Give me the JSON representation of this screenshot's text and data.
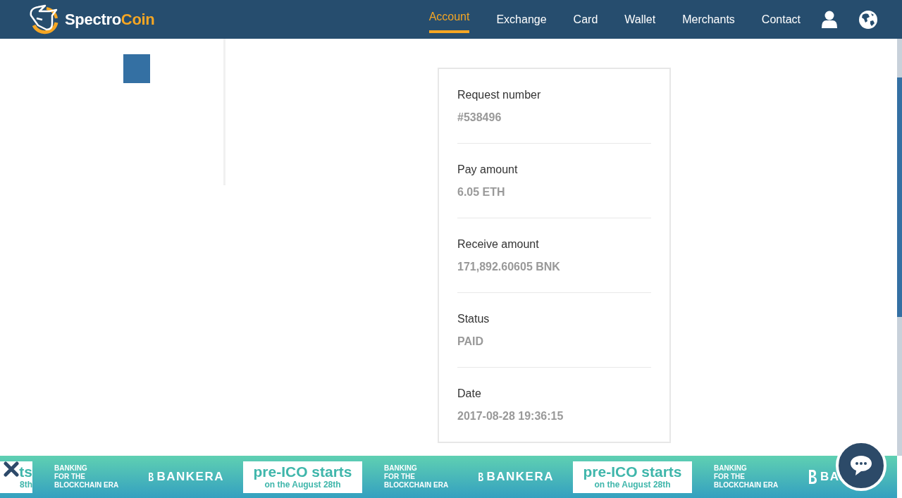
{
  "header": {
    "logo": {
      "first": "Spectro",
      "second": "Coin"
    },
    "nav": [
      {
        "label": "Account",
        "selected": true
      },
      {
        "label": "Exchange",
        "selected": false
      },
      {
        "label": "Card",
        "selected": false
      },
      {
        "label": "Wallet",
        "selected": false
      },
      {
        "label": "Merchants",
        "selected": false
      },
      {
        "label": "Contact",
        "selected": false
      }
    ]
  },
  "details": [
    {
      "label": "Request number",
      "value": "#538496"
    },
    {
      "label": "Pay amount",
      "value": "6.05 ETH"
    },
    {
      "label": "Receive amount",
      "value": "171,892.60605 BNK"
    },
    {
      "label": "Status",
      "value": "PAID"
    },
    {
      "label": "Date",
      "value": "2017-08-28 19:36:15"
    }
  ],
  "banner": {
    "segments": [
      {
        "kind": "promo-cut",
        "title": "ts",
        "subtitle": "8th"
      },
      {
        "kind": "tagline",
        "lines": [
          "BANKING",
          "FOR THE",
          "BLOCKCHAIN ERA"
        ]
      },
      {
        "kind": "brand",
        "text": "BANKERA"
      },
      {
        "kind": "promo",
        "title": "pre-ICO starts",
        "subtitle": "on the August 28th"
      },
      {
        "kind": "tagline",
        "lines": [
          "BANKING",
          "FOR THE",
          "BLOCKCHAIN ERA"
        ]
      },
      {
        "kind": "brand",
        "text": "BANKERA"
      },
      {
        "kind": "promo",
        "title": "pre-ICO starts",
        "subtitle": "on the August 28th"
      },
      {
        "kind": "tagline",
        "lines": [
          "BANKING",
          "FOR THE",
          "BLOCKCHAIN ERA"
        ]
      },
      {
        "kind": "brand",
        "text": "BA"
      }
    ]
  }
}
